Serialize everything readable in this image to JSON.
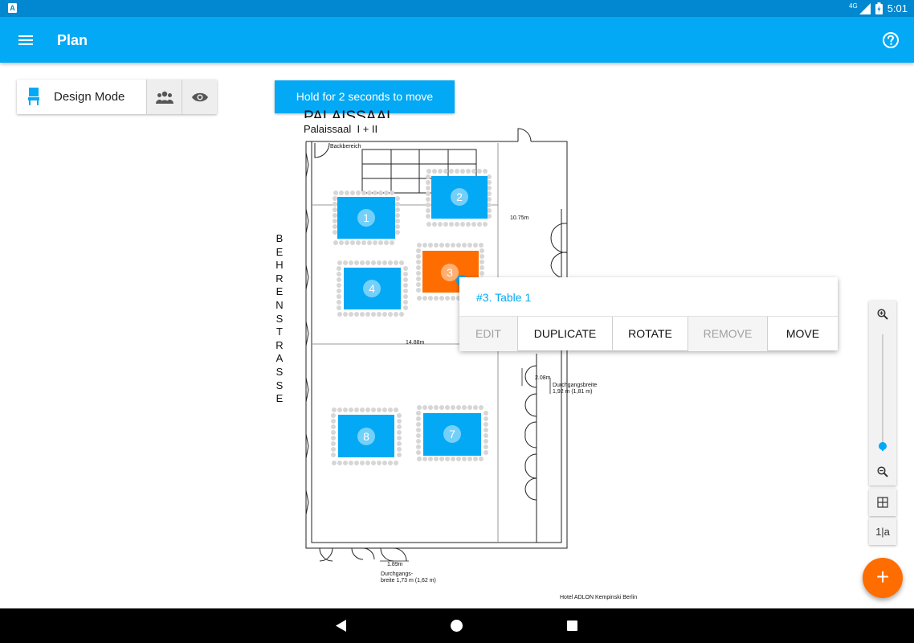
{
  "status_bar": {
    "left_icon": "A",
    "network": "4G",
    "time": "5:01",
    "icons": [
      "signal-icon",
      "battery-icon"
    ]
  },
  "app_bar": {
    "title": "Plan",
    "menu_icon": "hamburger-icon",
    "help_icon": "help-circle-icon",
    "color": "#03a9f4"
  },
  "mode_bar": {
    "design_label": "Design Mode",
    "icons": [
      "chair-icon",
      "people-icon",
      "eye-icon"
    ]
  },
  "toast": {
    "text": "Hold for 2 seconds to move"
  },
  "floorplan": {
    "hall_title": "PALAISSAAL",
    "hall_subtitle": "Palaissaal  I + II",
    "backbereich": "Backbereich",
    "street": [
      "B",
      "E",
      "H",
      "R",
      "E",
      "N",
      "S",
      "T",
      "R",
      "A",
      "S",
      "S",
      "E"
    ],
    "dim_width": "10.75m",
    "dim_length": "14.88m",
    "dim_side": "2.08m",
    "passage_right_1": "Durchgangsbreite",
    "passage_right_2": "1,92 m (1,81 m)",
    "dim_bottom": "1.89m",
    "passage_bottom_1": "Durchgangs-",
    "passage_bottom_2": "breite 1,73 m (1,62 m)",
    "hotel": "Hotel ADLON Kempinski Berlin"
  },
  "tables": [
    {
      "number": "1",
      "selected": false
    },
    {
      "number": "2",
      "selected": false
    },
    {
      "number": "3",
      "selected": true
    },
    {
      "number": "4",
      "selected": false
    },
    {
      "number": "8",
      "selected": false
    },
    {
      "number": "7",
      "selected": false
    }
  ],
  "colors": {
    "table": "#03a9f4",
    "selected_table": "#ff6d00",
    "chair": "#d6d6d6"
  },
  "context_menu": {
    "title": "#3. Table 1",
    "actions": [
      {
        "label": "EDIT",
        "enabled": false
      },
      {
        "label": "DUPLICATE",
        "enabled": true
      },
      {
        "label": "ROTATE",
        "enabled": true
      },
      {
        "label": "REMOVE",
        "enabled": false
      },
      {
        "label": "MOVE",
        "enabled": true
      }
    ]
  },
  "zoom": {
    "level": 0.07,
    "zoom_in_icon": "zoom-in-icon",
    "zoom_out_icon": "zoom-out-icon"
  },
  "side_buttons": {
    "grid_icon": "grid-icon",
    "label_toggle": "1|a"
  },
  "fab": {
    "label": "+"
  },
  "nav_bar": {
    "icons": [
      "back-icon",
      "home-icon",
      "recents-icon"
    ]
  }
}
